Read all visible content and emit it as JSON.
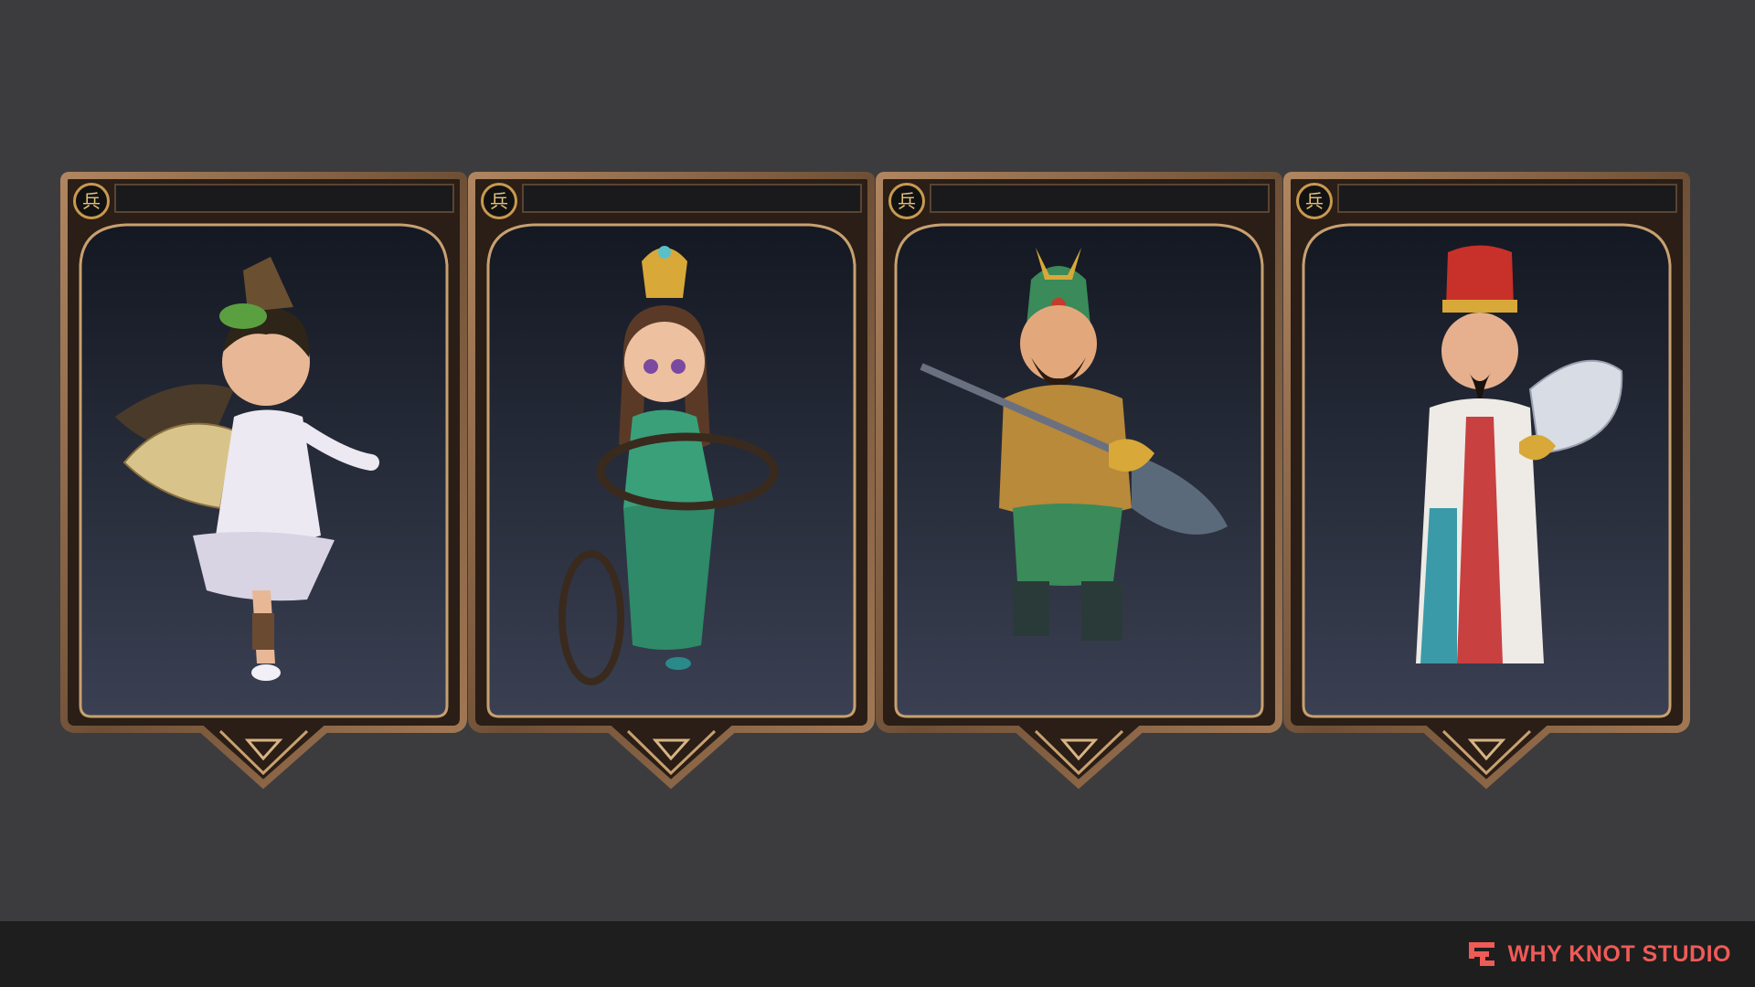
{
  "cards": [
    {
      "badge": "兵",
      "character": "fan-dancer-heroine"
    },
    {
      "badge": "兵",
      "character": "hoop-dancer-heroine"
    },
    {
      "badge": "兵",
      "character": "green-dragon-general"
    },
    {
      "badge": "兵",
      "character": "feather-fan-strategist"
    }
  ],
  "footer": {
    "brand_name": "WHY KNOT STUDIO",
    "brand_color": "#ef5b57"
  },
  "colors": {
    "background": "#3c3c3e",
    "footer": "#1e1e1e",
    "frame_bronze": "#8b6a4a",
    "card_inner_top": "#161a24",
    "card_inner_bottom": "#3a4052"
  }
}
